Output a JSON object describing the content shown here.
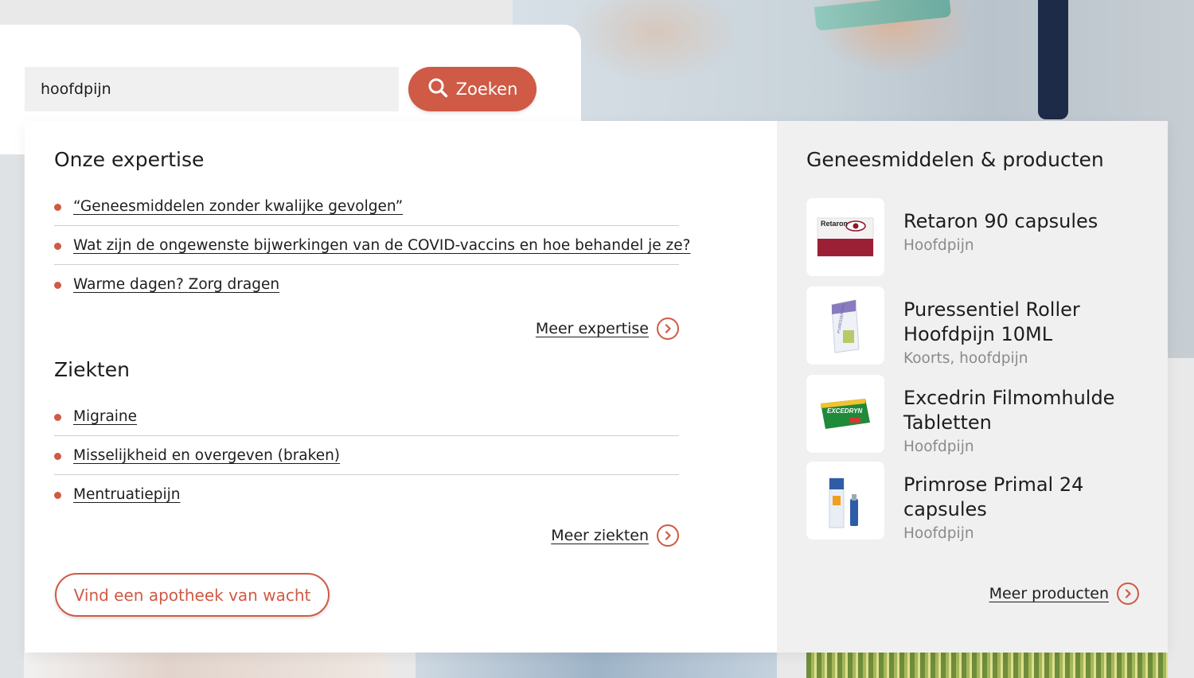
{
  "search": {
    "value": "hoofdpijn",
    "button_label": "Zoeken"
  },
  "expertise": {
    "title": "Onze expertise",
    "items": [
      {
        "label": "“Geneesmiddelen zonder kwalijke gevolgen”"
      },
      {
        "label": "Wat zijn de ongewenste bijwerkingen van de COVID-vaccins en hoe behandel je ze?"
      },
      {
        "label": "Warme dagen? Zorg dragen"
      }
    ],
    "more_label": "Meer expertise"
  },
  "diseases": {
    "title": "Ziekten",
    "items": [
      {
        "label": "Migraine"
      },
      {
        "label": "Misselijkheid en overgeven (braken)"
      },
      {
        "label": "Mentruatiepijn"
      }
    ],
    "more_label": "Meer ziekten"
  },
  "pharmacy_button": "Vind een apotheek van wacht",
  "products": {
    "title": "Geneesmiddelen & producten",
    "items": [
      {
        "name": "Retaron 90 capsules",
        "category": "Hoofdpijn",
        "thumb_text": "Retaron"
      },
      {
        "name": "Puressentiel Roller Hoofdpijn 10ML",
        "category": "Koorts, hoofdpijn",
        "thumb_text": "PURESSENTIEL"
      },
      {
        "name": "Excedrin Filmomhulde Tabletten",
        "category": "Hoofdpijn",
        "thumb_text": "EXCEDRYN"
      },
      {
        "name": "Primrose Primal 24 capsules",
        "category": "Hoofdpijn",
        "thumb_text": ""
      }
    ],
    "more_label": "Meer producten"
  },
  "colors": {
    "accent": "#cf5a45",
    "panel_gray": "#f0f0f0",
    "muted_text": "#8a8a8a"
  }
}
